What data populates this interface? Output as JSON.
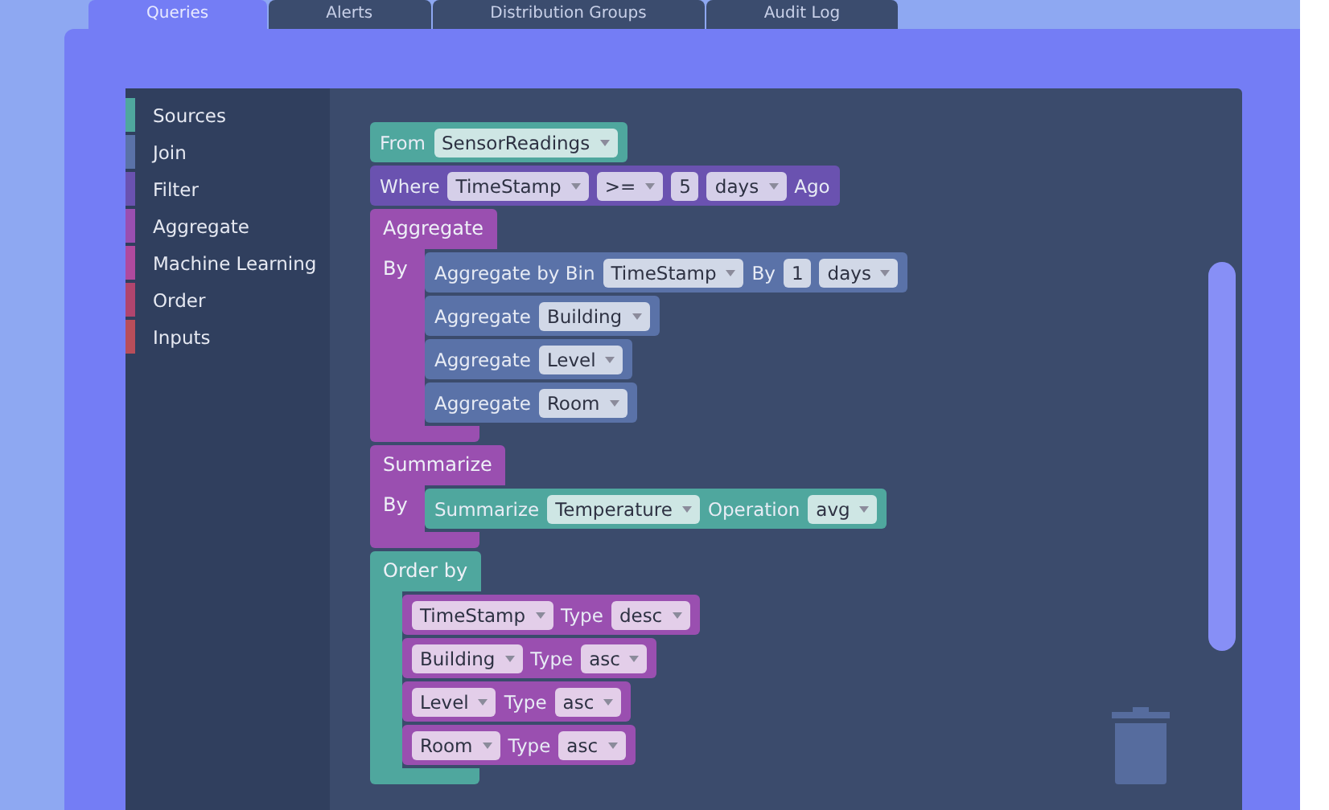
{
  "tabs": [
    {
      "label": "Queries",
      "selected": true
    },
    {
      "label": "Alerts",
      "selected": false
    },
    {
      "label": "Distribution Groups",
      "selected": false
    },
    {
      "label": "Audit Log",
      "selected": false
    }
  ],
  "toolbox": [
    {
      "label": "Sources",
      "color": "#4fa79e"
    },
    {
      "label": "Join",
      "color": "#5a72a8"
    },
    {
      "label": "Filter",
      "color": "#6a52b0"
    },
    {
      "label": "Aggregate",
      "color": "#9a4fb0"
    },
    {
      "label": "Machine Learning",
      "color": "#b04a9e"
    },
    {
      "label": "Order",
      "color": "#b0456e"
    },
    {
      "label": "Inputs",
      "color": "#b84e5a"
    }
  ],
  "blocks": [
    {
      "kind": "statement",
      "color": "#4fa79e",
      "parts": [
        {
          "kind": "text",
          "text": "From"
        },
        {
          "kind": "dropdown",
          "text": "SensorReadings"
        }
      ]
    },
    {
      "kind": "statement",
      "color": "#6a52b0",
      "parts": [
        {
          "kind": "text",
          "text": "Where"
        },
        {
          "kind": "dropdown",
          "text": "TimeStamp"
        },
        {
          "kind": "dropdown",
          "text": ">="
        },
        {
          "kind": "number",
          "text": "5"
        },
        {
          "kind": "dropdown",
          "text": "days"
        },
        {
          "kind": "text",
          "text": "Ago"
        }
      ]
    },
    {
      "kind": "container",
      "color": "#9a4fb0",
      "header": "Aggregate",
      "slot": "By",
      "children": [
        {
          "kind": "statement",
          "color": "#5a72a8",
          "parts": [
            {
              "kind": "text",
              "text": "Aggregate by Bin"
            },
            {
              "kind": "dropdown",
              "text": "TimeStamp"
            },
            {
              "kind": "text",
              "text": "By"
            },
            {
              "kind": "number",
              "text": "1"
            },
            {
              "kind": "dropdown",
              "text": "days"
            }
          ]
        },
        {
          "kind": "statement",
          "color": "#5a72a8",
          "parts": [
            {
              "kind": "text",
              "text": "Aggregate"
            },
            {
              "kind": "dropdown",
              "text": "Building"
            }
          ]
        },
        {
          "kind": "statement",
          "color": "#5a72a8",
          "parts": [
            {
              "kind": "text",
              "text": "Aggregate"
            },
            {
              "kind": "dropdown",
              "text": "Level"
            }
          ]
        },
        {
          "kind": "statement",
          "color": "#5a72a8",
          "parts": [
            {
              "kind": "text",
              "text": "Aggregate"
            },
            {
              "kind": "dropdown",
              "text": "Room"
            }
          ]
        }
      ]
    },
    {
      "kind": "container",
      "color": "#9a4fb0",
      "header": "Summarize",
      "slot": "By",
      "children": [
        {
          "kind": "statement",
          "color": "#4fa79e",
          "parts": [
            {
              "kind": "text",
              "text": "Summarize"
            },
            {
              "kind": "dropdown",
              "text": "Temperature"
            },
            {
              "kind": "text",
              "text": "Operation"
            },
            {
              "kind": "dropdown",
              "text": "avg"
            }
          ]
        }
      ]
    },
    {
      "kind": "container",
      "color": "#4fa79e",
      "header": "Order by",
      "children": [
        {
          "kind": "statement",
          "color": "#9a4fb0",
          "parts": [
            {
              "kind": "dropdown",
              "text": "TimeStamp"
            },
            {
              "kind": "text",
              "text": "Type"
            },
            {
              "kind": "dropdown",
              "text": "desc"
            }
          ]
        },
        {
          "kind": "statement",
          "color": "#9a4fb0",
          "parts": [
            {
              "kind": "dropdown",
              "text": "Building"
            },
            {
              "kind": "text",
              "text": "Type"
            },
            {
              "kind": "dropdown",
              "text": "asc"
            }
          ]
        },
        {
          "kind": "statement",
          "color": "#9a4fb0",
          "parts": [
            {
              "kind": "dropdown",
              "text": "Level"
            },
            {
              "kind": "text",
              "text": "Type"
            },
            {
              "kind": "dropdown",
              "text": "asc"
            }
          ]
        },
        {
          "kind": "statement",
          "color": "#9a4fb0",
          "parts": [
            {
              "kind": "dropdown",
              "text": "Room"
            },
            {
              "kind": "text",
              "text": "Type"
            },
            {
              "kind": "dropdown",
              "text": "asc"
            }
          ]
        }
      ]
    }
  ]
}
